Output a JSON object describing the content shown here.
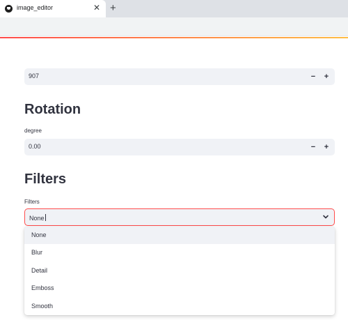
{
  "browser": {
    "tab_title": "image_editor",
    "tab_close": "✕",
    "new_tab": "+"
  },
  "number_input_top": {
    "value": "907",
    "minus": "−",
    "plus": "+"
  },
  "rotation": {
    "header": "Rotation",
    "label": "degree",
    "value": "0.00",
    "minus": "−",
    "plus": "+"
  },
  "filters": {
    "header": "Filters",
    "label": "Filters",
    "selected": "None",
    "options": [
      "None",
      "Blur",
      "Detail",
      "Emboss",
      "Smooth"
    ],
    "highlighted_index": 0
  },
  "colors": {
    "accent": "#ff4b4b",
    "input_bg": "#f0f2f6",
    "text": "#31333f"
  }
}
